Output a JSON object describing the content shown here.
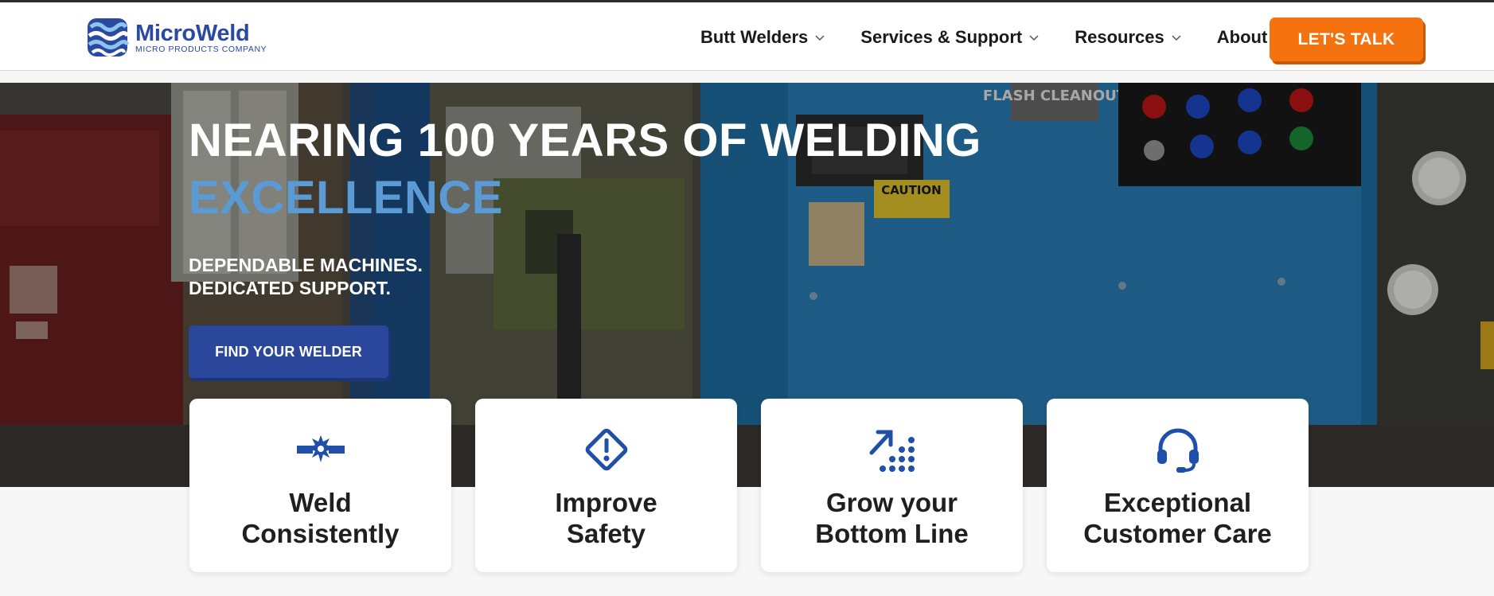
{
  "brand": {
    "name": "MicroWeld",
    "tagline": "MICRO PRODUCTS COMPANY",
    "primary_color": "#2a4aa1",
    "accent_color": "#f4730f"
  },
  "nav": {
    "items": [
      {
        "label": "Butt Welders"
      },
      {
        "label": "Services & Support"
      },
      {
        "label": "Resources"
      },
      {
        "label": "About"
      }
    ],
    "cta_label": "LET'S TALK"
  },
  "hero": {
    "title_line1": "NEARING 100 YEARS OF WELDING",
    "title_line2": "EXCELLENCE",
    "subtitle_line1": "DEPENDABLE MACHINES.",
    "subtitle_line2": "DEDICATED SUPPORT.",
    "button_label": "FIND YOUR WELDER",
    "machine_sign": "FLASH CLEANOUT",
    "caution_label": "CAUTION"
  },
  "features": [
    {
      "icon": "weld-spark-icon",
      "line1": "Weld",
      "line2": "Consistently"
    },
    {
      "icon": "warning-diamond-icon",
      "line1": "Improve",
      "line2": "Safety"
    },
    {
      "icon": "growth-arrow-icon",
      "line1": "Grow your",
      "line2": "Bottom Line"
    },
    {
      "icon": "headset-icon",
      "line1": "Exceptional",
      "line2": "Customer Care"
    }
  ]
}
